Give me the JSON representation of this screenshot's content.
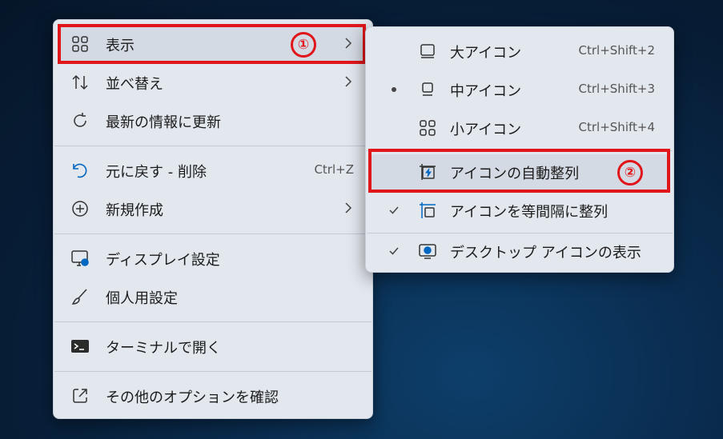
{
  "main_menu": {
    "items": [
      {
        "label": "表示",
        "icon": "grid-icon",
        "has_submenu": true,
        "step": "①"
      },
      {
        "label": "並べ替え",
        "icon": "sort-icon",
        "has_submenu": true
      },
      {
        "label": "最新の情報に更新",
        "icon": "refresh-icon"
      },
      {
        "label": "元に戻す - 削除",
        "icon": "undo-icon",
        "shortcut": "Ctrl+Z"
      },
      {
        "label": "新規作成",
        "icon": "add-circle-icon",
        "has_submenu": true
      },
      {
        "label": "ディスプレイ設定",
        "icon": "display-settings-icon"
      },
      {
        "label": "個人用設定",
        "icon": "brush-icon"
      },
      {
        "label": "ターミナルで開く",
        "icon": "terminal-icon"
      },
      {
        "label": "その他のオプションを確認",
        "icon": "open-external-icon"
      }
    ]
  },
  "sub_menu": {
    "items": [
      {
        "label": "大アイコン",
        "icon": "monitor-large-icon",
        "shortcut": "Ctrl+Shift+2"
      },
      {
        "label": "中アイコン",
        "icon": "monitor-medium-icon",
        "shortcut": "Ctrl+Shift+3",
        "selected": true
      },
      {
        "label": "小アイコン",
        "icon": "grid-small-icon",
        "shortcut": "Ctrl+Shift+4"
      },
      {
        "label": "アイコンの自動整列",
        "icon": "auto-arrange-icon",
        "step": "②"
      },
      {
        "label": "アイコンを等間隔に整列",
        "icon": "align-grid-icon",
        "checked": true
      },
      {
        "label": "デスクトップ アイコンの表示",
        "icon": "desktop-icons-icon",
        "checked": true
      }
    ]
  },
  "colors": {
    "highlight_red": "#e0161b",
    "accent_blue": "#0067c0"
  }
}
